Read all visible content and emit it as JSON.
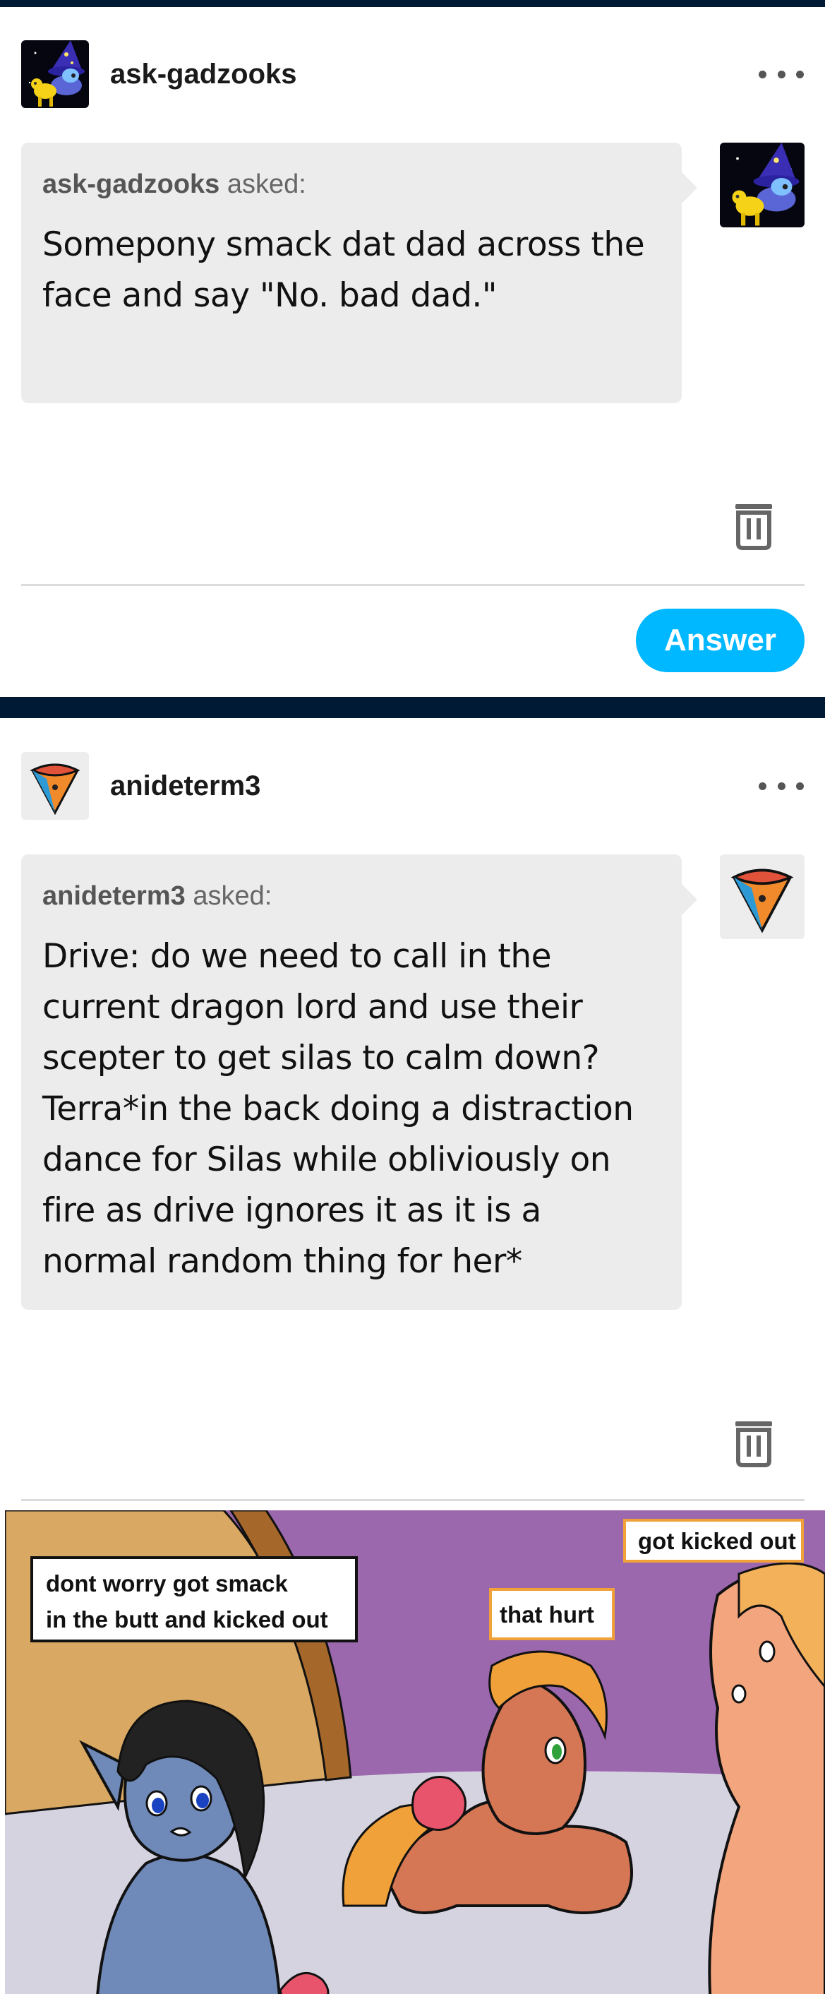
{
  "posts": [
    {
      "blog_name": "ask-gadzooks",
      "asker": "ask-gadzooks",
      "asked_label": "asked:",
      "question": "Somepony smack dat dad across the face and say \"No. bad dad.\"",
      "answer_label": "Answer",
      "icons": {
        "more": "more-options-icon",
        "delete": "trash-icon"
      }
    },
    {
      "blog_name": "anideterm3",
      "asker": "anideterm3",
      "asked_label": "asked:",
      "question": "Drive: do we need to call in the current dragon lord and use their scepter to get silas to calm down? Terra*in the back doing a distraction dance for Silas while obliviously on fire as drive ignores it as it is a normal random thing for her*",
      "icons": {
        "more": "more-options-icon",
        "delete": "trash-icon"
      }
    }
  ],
  "comic": {
    "bubbles": {
      "left_line1": "dont worry got smack",
      "left_line2": "in the butt and kicked out",
      "middle": "that hurt",
      "right": "got kicked out"
    }
  },
  "colors": {
    "background": "#001935",
    "accent_button": "#00b8ff",
    "bubble_bg": "#ececec"
  }
}
